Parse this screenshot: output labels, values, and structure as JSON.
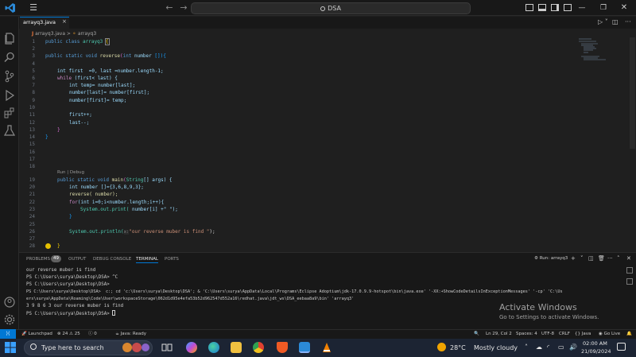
{
  "window": {
    "search": "DSA"
  },
  "tab": {
    "filename": "arrayq3.java",
    "close": "×"
  },
  "breadcrumb": {
    "file": "arrayq3.java",
    "sep": ">",
    "class": "arrayq3"
  },
  "codelens": "Run | Debug",
  "code_lines": [
    {
      "n": "1"
    },
    {
      "n": "2"
    },
    {
      "n": "3"
    },
    {
      "n": "4"
    },
    {
      "n": "5"
    },
    {
      "n": "6"
    },
    {
      "n": "7"
    },
    {
      "n": "8"
    },
    {
      "n": "9"
    },
    {
      "n": "10"
    },
    {
      "n": "11"
    },
    {
      "n": "12"
    },
    {
      "n": "13"
    },
    {
      "n": "14"
    },
    {
      "n": "15"
    },
    {
      "n": "16"
    },
    {
      "n": "17"
    },
    {
      "n": "18"
    },
    {
      "n": "19"
    },
    {
      "n": "20"
    },
    {
      "n": "21"
    },
    {
      "n": "22"
    },
    {
      "n": "23"
    },
    {
      "n": "24"
    },
    {
      "n": "25"
    },
    {
      "n": "26"
    },
    {
      "n": "27"
    },
    {
      "n": "28"
    }
  ],
  "code": {
    "l1_kw1": "public",
    "l1_kw2": "class",
    "l1_name": "arrayq3",
    "l1_brace": "{",
    "l3_kw": "public static void",
    "l3_fn": "reverse",
    "l3_type": "int",
    "l3_param": "number",
    "l3_rest": "[]){",
    "l5": "int first  =0, last =number.length-1;",
    "l6_kw": "while",
    "l6_rest": " (first< last) {",
    "l7": "int temp= number[last];",
    "l8": "number[last]= number[first];",
    "l9": "number[first]= temp;",
    "l11": "first++;",
    "l12": "last--;",
    "l13": "}",
    "l14": "}",
    "l19_kw": "public static void",
    "l19_fn": "main",
    "l19_type": "String",
    "l19_rest": "[] args) {",
    "l20": "int number []={3,6,8,9,3};",
    "l21": "reverse( number);",
    "l22_kw": "for",
    "l22_rest": "(int i=0;i<number.length;i++){",
    "l23_sys": "System.out.print(",
    "l23_rest": " number[i] +\" \");",
    "l24": "}",
    "l26_sys": "System.out.println(",
    "l26_hint": "x:",
    "l26_str": "\"our reverse muber is find \"",
    "l26_end": ");",
    "l28": "}"
  },
  "panel": {
    "tabs": [
      "PROBLEMS",
      "OUTPUT",
      "DEBUG CONSOLE",
      "TERMINAL",
      "PORTS"
    ],
    "problems_count": "49",
    "run_label": "Run: arrayq3"
  },
  "terminal_lines": [
    "our reverse muber is find",
    "PS C:\\Users\\surya\\Desktop\\DSA> ^C",
    "PS C:\\Users\\surya\\Desktop\\DSA>",
    "PS C:\\Users\\surya\\Desktop\\DSA>  c:; cd 'c:\\Users\\surya\\Desktop\\DSA'; & 'C:\\Users\\surya\\AppData\\Local\\Programs\\Eclipse Adoptium\\jdk-17.0.9.9-hotspot\\bin\\java.exe' '-XX:+ShowCodeDetailsInExceptionMessages' '-cp' 'C:\\Us",
    "ers\\surya\\AppData\\Roaming\\Code\\User\\workspaceStorage\\062d1d95e4efa53b52d962547d552a16\\redhat.java\\jdt_ws\\DSA_eebaa8a9\\bin' 'arrayq3'",
    "3 9 8 6 3 our reverse muber is find",
    "PS C:\\Users\\surya\\Desktop\\DSA> "
  ],
  "watermark": {
    "title": "Activate Windows",
    "sub": "Go to Settings to activate Windows."
  },
  "status": {
    "launchpad": "Launchpad",
    "errors": "24",
    "warnings": "25",
    "info": "0",
    "java": "Java: Ready",
    "position": "Ln 29, Col 2",
    "spaces": "Spaces: 4",
    "encoding": "UTF-8",
    "eol": "CRLF",
    "language": "Java",
    "golive": "Go Live"
  },
  "taskbar": {
    "search_placeholder": "Type here to search",
    "temp": "28°C",
    "weather": "Mostly cloudy",
    "time": "02:00 AM",
    "date": "21/09/2024"
  },
  "colors": {
    "accent": "#0078d4",
    "keyword": "#569cd6",
    "function": "#dcdcaa",
    "string": "#ce9178",
    "number": "#b5cea8",
    "variable": "#9cdcfe"
  }
}
